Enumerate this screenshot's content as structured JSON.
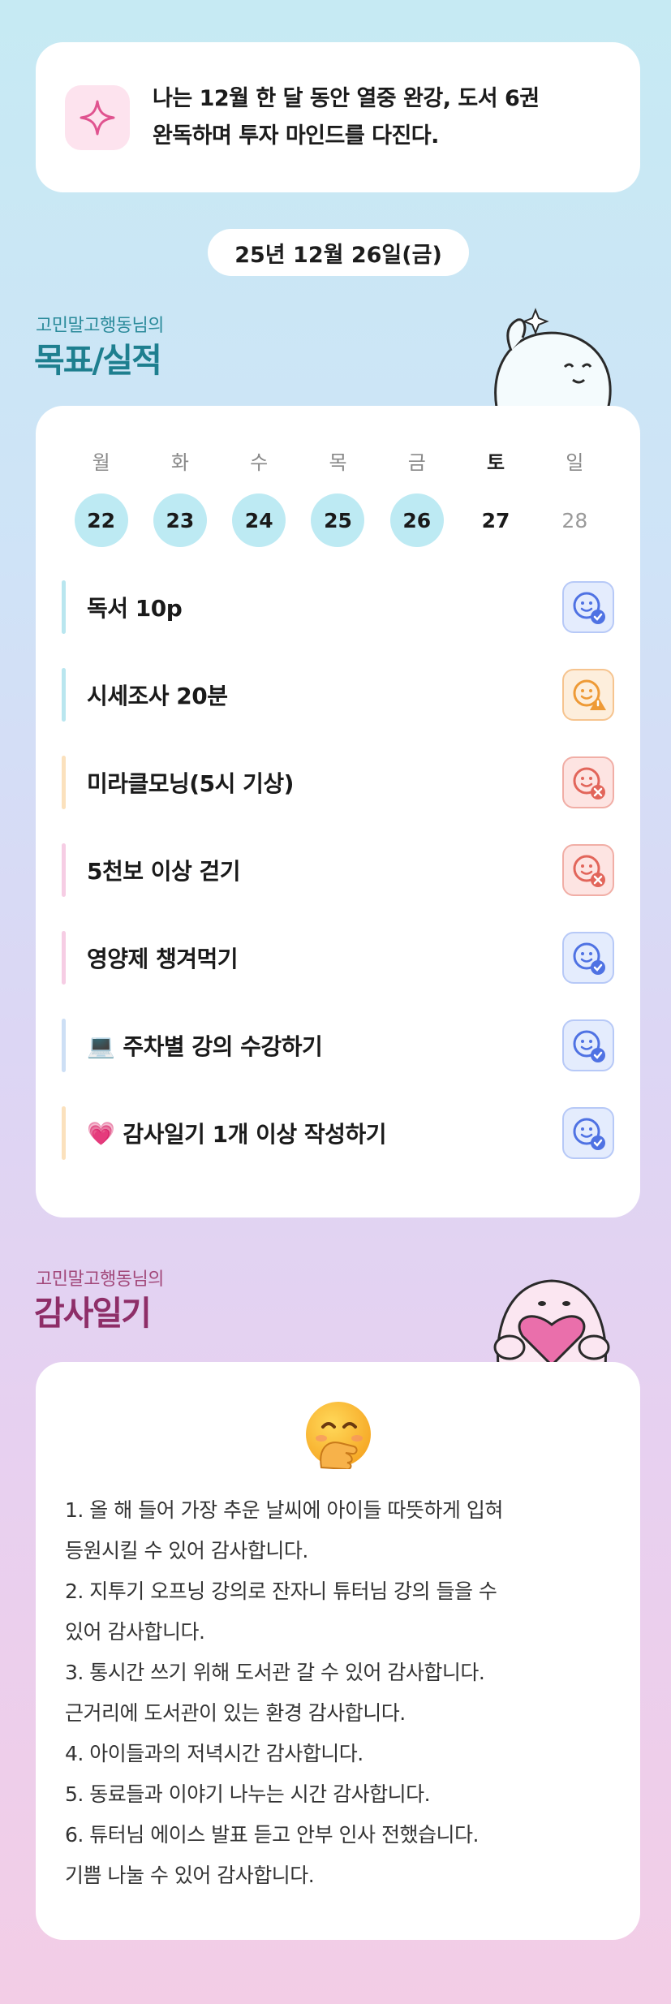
{
  "goal": {
    "icon": "sparkle-icon",
    "line1": "나는 12월 한 달 동안 열중 완강, 도서 6권",
    "line2": "완독하며 투자 마인드를 다진다."
  },
  "date_label": "25년 12월 26일(금)",
  "section_goals": {
    "subtitle": "고민말고행동님의",
    "title": "목표/실적"
  },
  "week": {
    "days": [
      "월",
      "화",
      "수",
      "목",
      "금",
      "토",
      "일"
    ],
    "dates": [
      "22",
      "23",
      "24",
      "25",
      "26",
      "27",
      "28"
    ]
  },
  "tasks": [
    {
      "label": "독서 10p",
      "emoji": "",
      "status": "good-face-icon",
      "bar_color": "#b9e6ef"
    },
    {
      "label": "시세조사 20분",
      "emoji": "",
      "status": "warning-face-icon",
      "bar_color": "#b9e6ef"
    },
    {
      "label": "미라클모닝(5시 기상)",
      "emoji": "",
      "status": "fail-face-icon",
      "bar_color": "#fbe1bd"
    },
    {
      "label": "5천보 이상 걷기",
      "emoji": "",
      "status": "fail-face-icon",
      "bar_color": "#f6cde4"
    },
    {
      "label": "영양제 챙겨먹기",
      "emoji": "",
      "status": "good-face-icon",
      "bar_color": "#f6cde4"
    },
    {
      "label": "주차별 강의 수강하기",
      "emoji": "💻",
      "status": "good-face-icon",
      "bar_color": "#cddff5"
    },
    {
      "label": "감사일기 1개 이상 작성하기",
      "emoji": "💗",
      "status": "good-face-icon",
      "bar_color": "#fbe1bd"
    }
  ],
  "section_gratitude": {
    "subtitle": "고민말고행동님의",
    "title": "감사일기"
  },
  "gratitude": {
    "emoji": "face-with-hand-over-mouth-icon",
    "lines": [
      "1. 올 해 들어 가장 추운 날씨에 아이들 따뜻하게 입혀",
      "등원시킬 수 있어 감사합니다.",
      "2. 지투기 오프닝 강의로 잔자니 튜터님 강의 들을 수",
      "있어 감사합니다.",
      "3. 통시간 쓰기 위해 도서관 갈 수 있어 감사합니다.",
      "근거리에 도서관이 있는 환경 감사합니다.",
      "4. 아이들과의 저녁시간 감사합니다.",
      "5. 동료들과 이야기 나누는 시간 감사합니다.",
      "6. 튜터님 에이스 발표 듣고 안부 인사 전했습니다.",
      "기쁨 나눌 수 있어 감사합니다."
    ]
  }
}
